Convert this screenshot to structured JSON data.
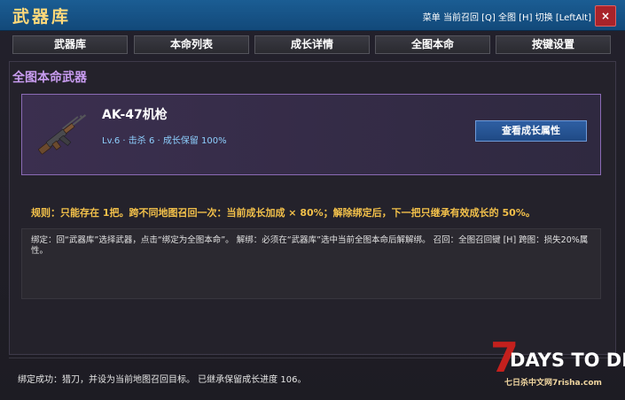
{
  "window": {
    "title": "武器库",
    "hint": "菜单 当前召回 [Q] 全图 [H] 切换 [LeftAlt]",
    "close_label": "×"
  },
  "tabs": [
    {
      "label": "武器库"
    },
    {
      "label": "本命列表"
    },
    {
      "label": "成长详情"
    },
    {
      "label": "全图本命"
    },
    {
      "label": "按键设置"
    }
  ],
  "main": {
    "section_title": "全图本命武器",
    "weapon": {
      "icon": "rifle-icon",
      "name": "AK-47机枪",
      "stats": "Lv.6 · 击杀 6 · 成长保留 100%",
      "button_label": "查看成长属性"
    },
    "rule": "规则：只能存在 1把。跨不同地图召回一次：当前成长加成 × 80%；解除绑定后，下一把只继承有效成长的 50%。",
    "info": "绑定：回“武器库”选择武器，点击“绑定为全图本命”。 解绑：必须在“武器库”选中当前全图本命后解解绑。 召回：全图召回键 [H] 跨图：损失20%属性。"
  },
  "status": "绑定成功：猎刀，并设为当前地图召回目标。 已继承保留成长进度 106。",
  "logo": {
    "big_char": "7",
    "text": "DAYS TO DIE",
    "site": "七日杀中文网7risha.com"
  },
  "colors": {
    "titlebar": "#1b5d93",
    "title_text": "#ffd97a",
    "section_title": "#c89cf0",
    "card_border": "#8b6bb5",
    "stats_text": "#8ed0ff",
    "rule_text": "#f2c04a",
    "close_button": "#a8232a",
    "logo_red": "#c4201d"
  }
}
